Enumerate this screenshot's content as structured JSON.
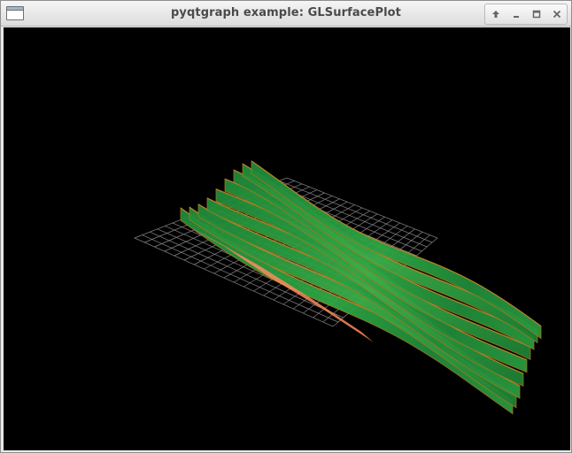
{
  "window": {
    "title": "pyqtgraph example: GLSurfacePlot"
  },
  "controls": [
    {
      "name": "shade-button",
      "icon": "up-arrow-icon"
    },
    {
      "name": "minimize-button",
      "icon": "minimize-icon"
    },
    {
      "name": "maximize-button",
      "icon": "maximize-icon"
    },
    {
      "name": "close-button",
      "icon": "close-icon"
    }
  ],
  "scene": {
    "background": "#000000",
    "grid_color": "#9a9a9a",
    "surface_colors": [
      "#1f8a3a",
      "#2fa845",
      "#7a9a1a",
      "#d47a2a",
      "#ff8a5a"
    ]
  }
}
